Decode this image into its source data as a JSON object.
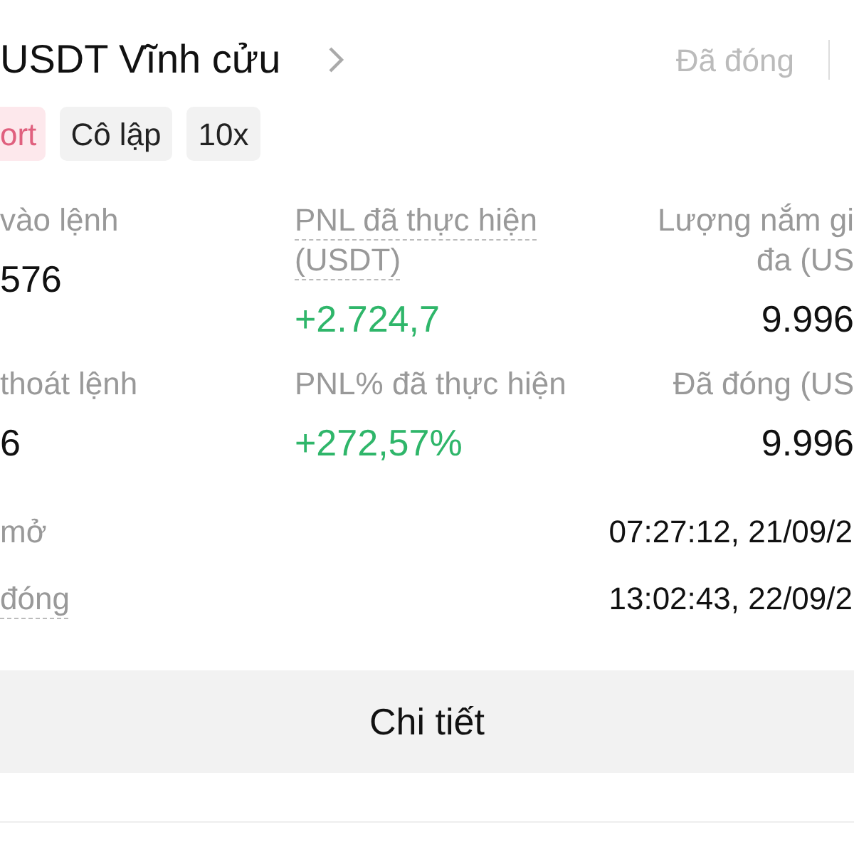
{
  "header": {
    "title": "USDT Vĩnh cửu",
    "status": "Đã đóng"
  },
  "tags": [
    {
      "label": "ort",
      "kind": "side"
    },
    {
      "label": "Cô lập",
      "kind": "plain"
    },
    {
      "label": "10x",
      "kind": "plain"
    }
  ],
  "stats": [
    [
      {
        "label": "vào lệnh",
        "value": "576",
        "color": "#111111",
        "dashed": false
      },
      {
        "label": "PNL đã thực hiện (USDT)",
        "value": "+2.724,7",
        "color": "#2fb66a",
        "dashed": true
      },
      {
        "label": "Lượng nắm gi đa (US",
        "value": "9.996",
        "color": "#111111",
        "dashed": false
      }
    ],
    [
      {
        "label": "thoát lệnh",
        "value": "6",
        "color": "#111111",
        "dashed": false
      },
      {
        "label": "PNL% đã thực hiện",
        "value": "+272,57%",
        "color": "#2fb66a",
        "dashed": false
      },
      {
        "label": "Đã đóng (US",
        "value": "9.996",
        "color": "#111111",
        "dashed": false
      }
    ]
  ],
  "times": [
    {
      "label": "mở",
      "value": "07:27:12, 21/09/2",
      "dashed": false
    },
    {
      "label": "đóng",
      "value": "13:02:43, 22/09/2",
      "dashed": true
    }
  ],
  "button": "Chi tiết"
}
